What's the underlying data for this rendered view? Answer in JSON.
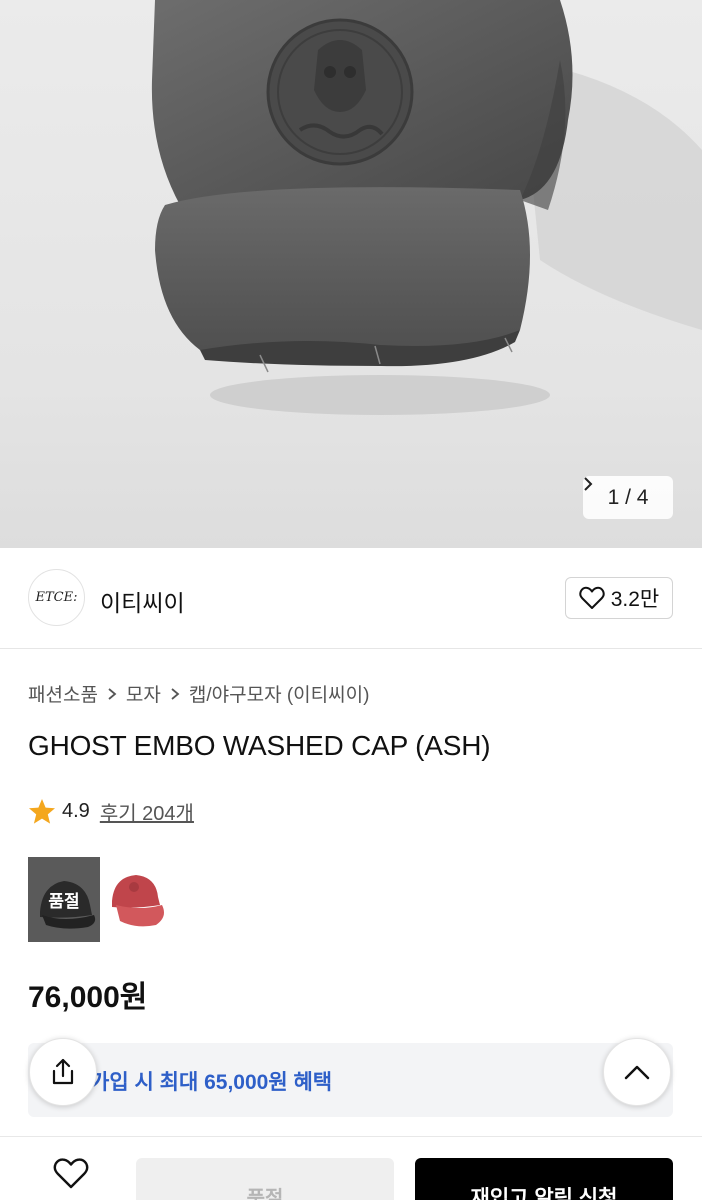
{
  "gallery": {
    "current_page": "1 / 4"
  },
  "brand": {
    "logo_text": "ETCE:",
    "name": "이티씨이",
    "likes": "3.2만"
  },
  "breadcrumb": [
    "패션소품",
    "모자",
    "캡/야구모자 (이티씨이)"
  ],
  "product": {
    "title": "GHOST EMBO WASHED CAP (ASH)",
    "rating": "4.9",
    "reviews": "후기 204개",
    "price": "76,000원"
  },
  "options": [
    {
      "badge": "품절"
    },
    {
      "badge": ""
    }
  ],
  "benefit": {
    "text": "가입 시 최대 65,000원 혜택"
  },
  "bottom": {
    "sold_label": "품절",
    "restock_label": "재입고 알림 신청"
  },
  "colors": {
    "accent_blue": "#2e5fc8",
    "star": "#f4a71e",
    "primary_button": "#000000"
  },
  "icons": [
    "chevron-right-icon",
    "heart-icon",
    "star-icon",
    "share-icon",
    "chevron-up-icon"
  ]
}
